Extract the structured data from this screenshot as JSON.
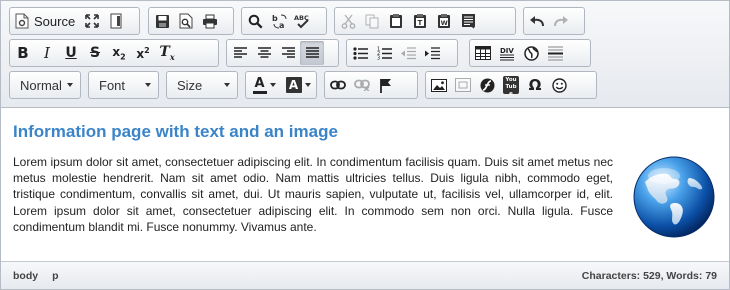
{
  "toolbar": {
    "source_label": "Source",
    "format_combo": "Normal",
    "font_combo": "Font",
    "size_combo": "Size",
    "text_color_letter": "A",
    "bg_color_letter": "A",
    "accent_color": "#3b84c8"
  },
  "icons": [
    "source-icon",
    "maximize-icon",
    "show-blocks-icon",
    "save-icon",
    "preview-icon",
    "print-icon",
    "find-icon",
    "replace-icon",
    "spellcheck-icon",
    "cut-icon",
    "copy-icon",
    "paste-icon",
    "paste-text-icon",
    "paste-word-icon",
    "templates-icon",
    "undo-icon",
    "redo-icon",
    "bold-icon",
    "italic-icon",
    "underline-icon",
    "strikethrough-icon",
    "subscript-icon",
    "superscript-icon",
    "remove-format-icon",
    "align-left-icon",
    "align-center-icon",
    "align-right-icon",
    "justify-icon",
    "bulleted-list-icon",
    "numbered-list-icon",
    "outdent-icon",
    "indent-icon",
    "table-icon",
    "div-icon",
    "language-icon",
    "horizontal-line-icon",
    "link-icon",
    "unlink-icon",
    "anchor-icon",
    "image-icon",
    "media-embed-icon",
    "flash-icon",
    "youtube-icon",
    "special-char-icon",
    "smiley-icon"
  ],
  "youtube_label": "You Tube",
  "content": {
    "title": "Information page with text and an image",
    "body": "Lorem ipsum dolor sit amet, consectetuer adipiscing elit. In condimentum facilisis quam. Duis sit amet metus nec metus molestie hendrerit. Nam sit amet odio. Nam mattis ultricies tellus. Duis ligula nibh, commodo eget, tristique condimentum, convallis sit amet, dui. Ut mauris sapien, vulputate ut, facilisis vel, ullamcorper id, elit. Lorem ipsum dolor sit amet, consectetuer adipiscing elit. In commodo sem non orci. Nulla ligula. Fusce condimentum blandit mi. Fusce nonummy. Vivamus ante."
  },
  "status": {
    "path": [
      "body",
      "p"
    ],
    "counter": "Characters: 529, Words: 79"
  }
}
